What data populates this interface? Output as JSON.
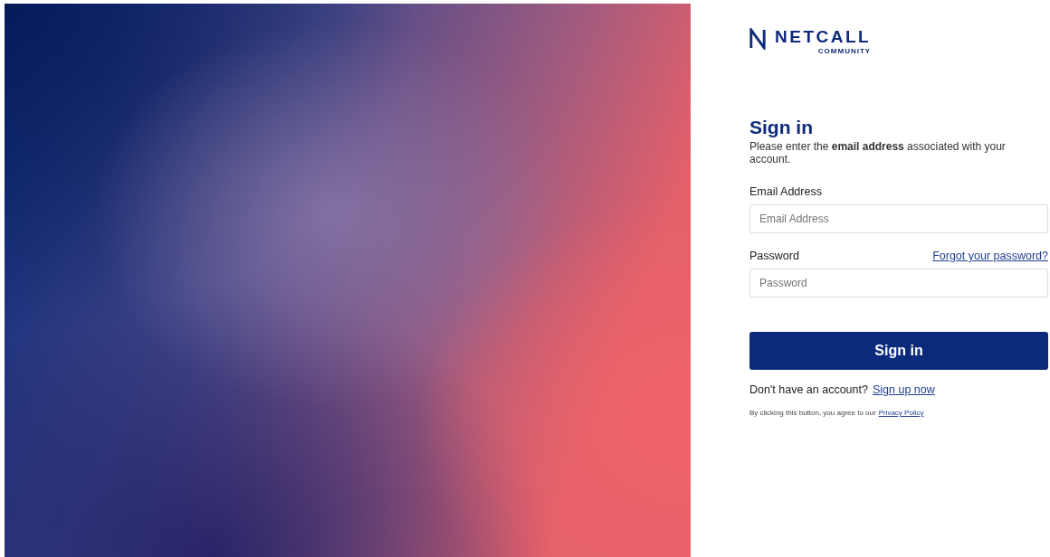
{
  "logo": {
    "name": "NETCALL",
    "tagline": "COMMUNITY"
  },
  "heading": "Sign in",
  "intro": "Please enter the **email address** associated with your account.",
  "fields": [
    {
      "label": "Email Address",
      "placeholder": "Email Address"
    },
    {
      "label": "Password",
      "placeholder": "Password",
      "link": "Forgot your password?"
    }
  ],
  "submit": "Sign in",
  "signup": {
    "text": "Don't have an account?",
    "link": "Sign up now"
  },
  "consent": {
    "text": "By clicking this button, you agree to our",
    "link": "Privacy Policy"
  }
}
